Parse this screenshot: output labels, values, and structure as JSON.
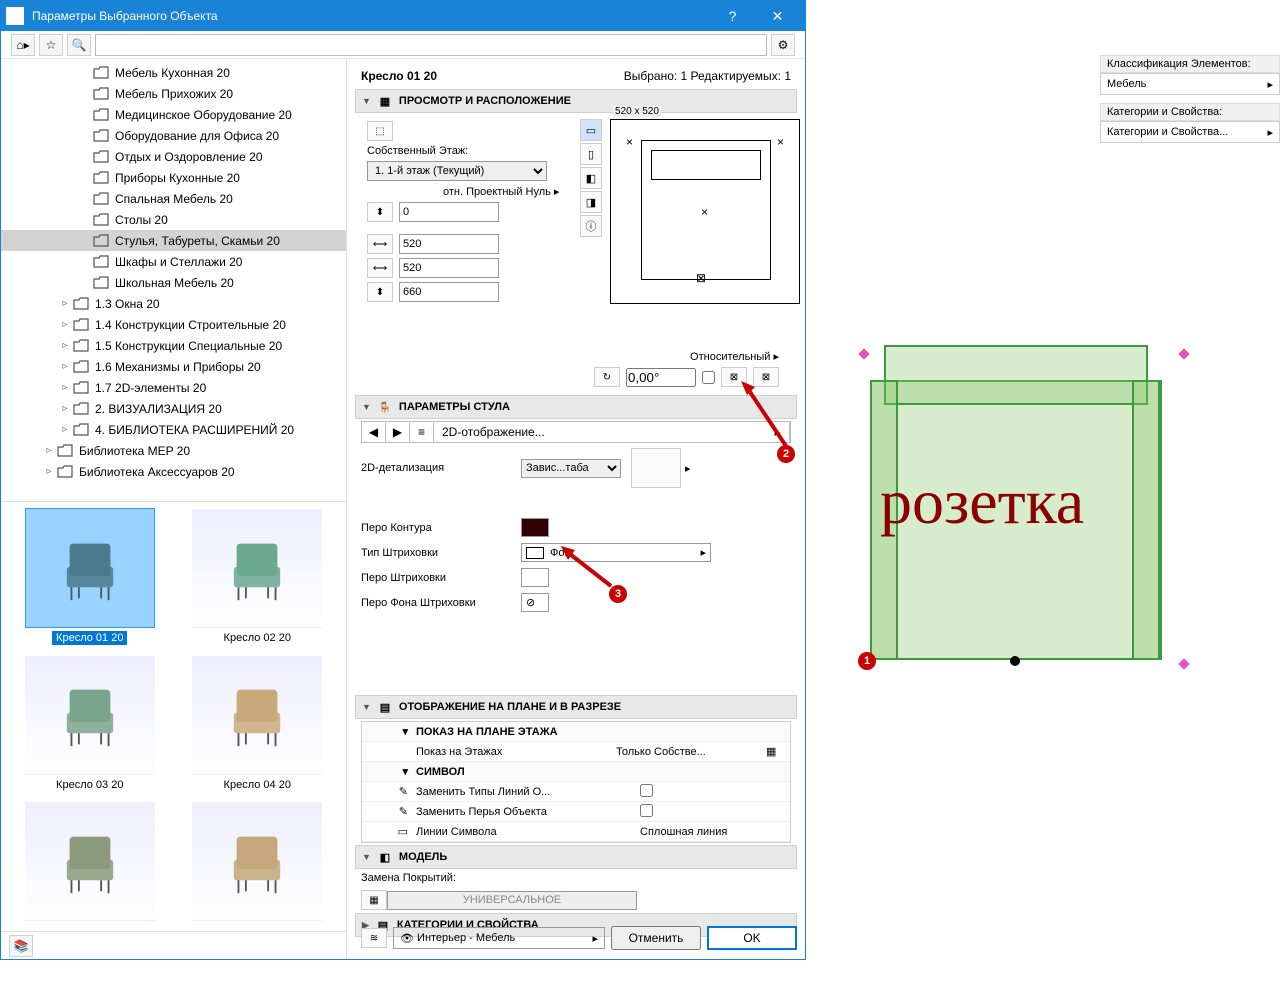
{
  "window": {
    "title": "Параметры Выбранного Объекта",
    "help": "?",
    "close": "✕"
  },
  "obj": {
    "name": "Кресло 01 20",
    "count": "Выбрано: 1 Редактируемых: 1"
  },
  "tree": [
    {
      "label": "Мебель Кухонная 20",
      "indent": 1
    },
    {
      "label": "Мебель Прихожих 20",
      "indent": 1
    },
    {
      "label": "Медицинское Оборудование 20",
      "indent": 1
    },
    {
      "label": "Оборудование для Офиса 20",
      "indent": 1
    },
    {
      "label": "Отдых и Оздоровление 20",
      "indent": 1
    },
    {
      "label": "Приборы Кухонные 20",
      "indent": 1
    },
    {
      "label": "Спальная Мебель 20",
      "indent": 1
    },
    {
      "label": "Столы 20",
      "indent": 1
    },
    {
      "label": "Стулья, Табуреты, Скамьи 20",
      "indent": 1,
      "sel": true
    },
    {
      "label": "Шкафы и Стеллажи 20",
      "indent": 1
    },
    {
      "label": "Школьная Мебель 20",
      "indent": 1
    },
    {
      "label": "1.3 Окна 20",
      "indent": 0,
      "exp": "▹"
    },
    {
      "label": "1.4 Конструкции Строительные 20",
      "indent": 0,
      "exp": "▹"
    },
    {
      "label": "1.5 Конструкции Специальные 20",
      "indent": 0,
      "exp": "▹"
    },
    {
      "label": "1.6 Механизмы и Приборы 20",
      "indent": 0,
      "exp": "▹"
    },
    {
      "label": "1.7 2D-элементы 20",
      "indent": 0,
      "exp": "▹"
    },
    {
      "label": "2. ВИЗУАЛИЗАЦИЯ 20",
      "indent": 0,
      "exp": "▹"
    },
    {
      "label": "4. БИБЛИОТЕКА РАСШИРЕНИЙ 20",
      "indent": 0,
      "exp": "▹"
    },
    {
      "label": "Библиотека MEP 20",
      "indent": -1,
      "exp": "▹"
    },
    {
      "label": "Библиотека Аксессуаров 20",
      "indent": -1,
      "exp": "▹"
    }
  ],
  "thumbs": [
    "Кресло 01 20",
    "Кресло 02 20",
    "Кресло 03 20",
    "Кресло 04 20",
    "",
    ""
  ],
  "sections": {
    "view": "ПРОСМОТР И РАСПОЛОЖЕНИЕ",
    "chair": "ПАРАМЕТРЫ СТУЛА",
    "plan": "ОТОБРАЖЕНИЕ НА ПЛАНЕ И В РАЗРЕЗЕ",
    "model": "МОДЕЛЬ",
    "cat": "КАТЕГОРИИ И СВОЙСТВА"
  },
  "pos": {
    "floor_label": "Собственный Этаж:",
    "floor_value": "1. 1-й этаж (Текущий)",
    "zero_label": "отн. Проектный Нуль ▸",
    "zero_value": "0",
    "dim_x": "520",
    "dim_y": "520",
    "dim_z": "660",
    "preview_size": "520 x 520",
    "relative_label": "Относительный ▸",
    "relative_value": "0,00°"
  },
  "chair_params": {
    "nav": "2D-отображение...",
    "detail_label": "2D-детализация",
    "detail_value": "Завис...таба",
    "kontur": "Перо Контура",
    "hatch_type": "Тип Штриховки",
    "hatch_type_val": "Фон",
    "hatch_pen": "Перо Штриховки",
    "hatch_bg": "Перо Фона Штриховки"
  },
  "plan_table": {
    "h1": "ПОКАЗ НА ПЛАНЕ ЭТАЖА",
    "r1a": "Показ на Этажах",
    "r1b": "Только Собстве...",
    "h2": "СИМВОЛ",
    "r2": "Заменить Типы Линий О...",
    "r3": "Заменить Перья Объекта",
    "r4a": "Линии Символа",
    "r4b": "Сплошная линия"
  },
  "model": {
    "override_label": "Замена Покрытий:",
    "universal": "УНИВЕРСАЛЬНОЕ"
  },
  "footer": {
    "layer": "Интерьер - Мебель",
    "cancel": "Отменить",
    "ok": "OK"
  },
  "rightpane": {
    "class_hdr": "Классификация Элементов:",
    "class_val": "Мебель",
    "cat_hdr": "Категории и Свойства:",
    "cat_val": "Категории и Свойства..."
  },
  "canvas_text": "розетка"
}
